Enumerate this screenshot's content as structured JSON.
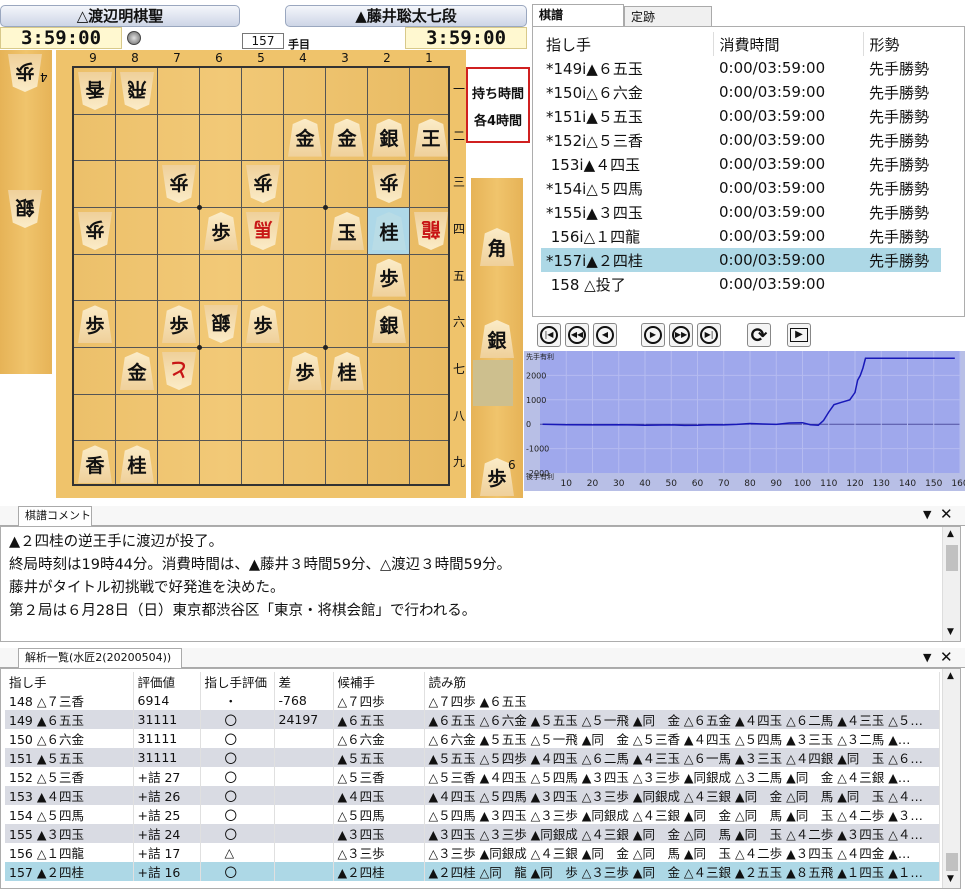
{
  "players": {
    "gote_name": "△渡辺明棋聖",
    "sente_name": "▲藤井聡太七段",
    "gote_clock": "3:59:00",
    "sente_clock": "3:59:00",
    "move_number": "157",
    "move_unit": "手目"
  },
  "time_limit": {
    "line1": "持ち時間",
    "line2": "各4時間"
  },
  "board": {
    "col_labels": [
      "9",
      "8",
      "7",
      "6",
      "5",
      "4",
      "3",
      "2",
      "1"
    ],
    "row_labels": [
      "一",
      "二",
      "三",
      "四",
      "五",
      "六",
      "七",
      "八",
      "九"
    ],
    "pieces": [
      {
        "c": 0,
        "r": 0,
        "t": "香",
        "s": "gote"
      },
      {
        "c": 1,
        "r": 0,
        "t": "飛",
        "s": "gote"
      },
      {
        "c": 5,
        "r": 1,
        "t": "金",
        "s": "sente"
      },
      {
        "c": 6,
        "r": 1,
        "t": "金",
        "s": "sente"
      },
      {
        "c": 7,
        "r": 1,
        "t": "銀",
        "s": "sente"
      },
      {
        "c": 8,
        "r": 1,
        "t": "王",
        "s": "sente"
      },
      {
        "c": 2,
        "r": 2,
        "t": "歩",
        "s": "gote"
      },
      {
        "c": 4,
        "r": 2,
        "t": "歩",
        "s": "gote"
      },
      {
        "c": 7,
        "r": 2,
        "t": "歩",
        "s": "gote"
      },
      {
        "c": 0,
        "r": 3,
        "t": "歩",
        "s": "gote"
      },
      {
        "c": 3,
        "r": 3,
        "t": "歩",
        "s": "sente"
      },
      {
        "c": 4,
        "r": 3,
        "t": "馬",
        "s": "gote",
        "red": true
      },
      {
        "c": 6,
        "r": 3,
        "t": "玉",
        "s": "sente"
      },
      {
        "c": 7,
        "r": 3,
        "t": "桂",
        "s": "sente",
        "hl": true
      },
      {
        "c": 8,
        "r": 3,
        "t": "龍",
        "s": "gote",
        "red": true
      },
      {
        "c": 7,
        "r": 4,
        "t": "歩",
        "s": "sente"
      },
      {
        "c": 0,
        "r": 5,
        "t": "歩",
        "s": "sente"
      },
      {
        "c": 2,
        "r": 5,
        "t": "歩",
        "s": "sente"
      },
      {
        "c": 3,
        "r": 5,
        "t": "銀",
        "s": "gote"
      },
      {
        "c": 4,
        "r": 5,
        "t": "歩",
        "s": "sente"
      },
      {
        "c": 7,
        "r": 5,
        "t": "銀",
        "s": "sente"
      },
      {
        "c": 1,
        "r": 6,
        "t": "金",
        "s": "sente"
      },
      {
        "c": 2,
        "r": 6,
        "t": "と",
        "s": "gote",
        "red": true
      },
      {
        "c": 5,
        "r": 6,
        "t": "歩",
        "s": "sente"
      },
      {
        "c": 6,
        "r": 6,
        "t": "桂",
        "s": "sente"
      },
      {
        "c": 0,
        "r": 8,
        "t": "香",
        "s": "sente"
      },
      {
        "c": 1,
        "r": 8,
        "t": "桂",
        "s": "sente"
      }
    ]
  },
  "hands": {
    "gote": [
      {
        "t": "歩",
        "count": "4"
      },
      {
        "t": "銀",
        "count": ""
      }
    ],
    "sente": [
      {
        "t": "角",
        "count": ""
      },
      {
        "t": "銀",
        "count": ""
      },
      {
        "t": "歩",
        "count": "6"
      }
    ]
  },
  "tabs": {
    "kifu": "棋譜",
    "track": "定跡"
  },
  "kifu": {
    "headers": [
      "指し手",
      "消費時間",
      "形勢"
    ],
    "rows": [
      {
        "move": "*149i▲６五玉",
        "time": "0:00/03:59:00",
        "eval": "先手勝勢"
      },
      {
        "move": "*150i△６六金",
        "time": "0:00/03:59:00",
        "eval": "先手勝勢"
      },
      {
        "move": "*151i▲５五玉",
        "time": "0:00/03:59:00",
        "eval": "先手勝勢"
      },
      {
        "move": "*152i△５三香",
        "time": "0:00/03:59:00",
        "eval": "先手勝勢"
      },
      {
        "move": " 153i▲４四玉",
        "time": "0:00/03:59:00",
        "eval": "先手勝勢"
      },
      {
        "move": "*154i△５四馬",
        "time": "0:00/03:59:00",
        "eval": "先手勝勢"
      },
      {
        "move": "*155i▲３四玉",
        "time": "0:00/03:59:00",
        "eval": "先手勝勢"
      },
      {
        "move": " 156i△１四龍",
        "time": "0:00/03:59:00",
        "eval": "先手勝勢"
      },
      {
        "move": "*157i▲２四桂",
        "time": "0:00/03:59:00",
        "eval": "先手勝勢"
      },
      {
        "move": " 158 △投了",
        "time": "0:00/03:59:00",
        "eval": ""
      }
    ],
    "selected": 8
  },
  "graph": {
    "top_label": "先手有利",
    "bottom_label": "後手有利",
    "y_ticks": [
      "2000",
      "1000",
      "0",
      "-1000",
      "-2000"
    ],
    "x_ticks": [
      "10",
      "20",
      "30",
      "40",
      "50",
      "60",
      "70",
      "80",
      "90",
      "100",
      "110",
      "120",
      "130",
      "140",
      "150",
      "160"
    ]
  },
  "chart_data": {
    "type": "line",
    "title": "",
    "xlabel": "",
    "ylabel": "",
    "xlim": [
      0,
      160
    ],
    "ylim": [
      -2000,
      3000
    ],
    "series": [
      {
        "name": "",
        "x": [
          1,
          10,
          20,
          30,
          40,
          50,
          55,
          60,
          65,
          70,
          75,
          80,
          85,
          90,
          95,
          100,
          103,
          106,
          108,
          110,
          112,
          115,
          118,
          120,
          121,
          122,
          123,
          124,
          130,
          140,
          150,
          158
        ],
        "values": [
          0,
          -20,
          -30,
          -20,
          -40,
          -30,
          -50,
          -40,
          -20,
          -30,
          -10,
          30,
          10,
          -10,
          50,
          60,
          -20,
          -40,
          150,
          500,
          800,
          900,
          1000,
          1300,
          1800,
          2000,
          2300,
          2700,
          2700,
          2700,
          2700,
          2700
        ]
      }
    ]
  },
  "comment": {
    "tab": "棋譜コメント",
    "lines": [
      "▲２四桂の逆王手に渡辺が投了。",
      "終局時刻は19時44分。消費時間は、▲藤井３時間59分、△渡辺３時間59分。",
      "藤井がタイトル初挑戦で好発進を決めた。",
      "第２局は６月28日（日）東京都渋谷区「東京・将棋会館」で行われる。"
    ]
  },
  "analysis": {
    "tab": "解析一覧(水匠2(20200504))",
    "headers": [
      "指し手",
      "評価値",
      "指し手評価",
      "差",
      "候補手",
      "読み筋"
    ],
    "rows": [
      {
        "move": "148 △７三香",
        "score": "6914",
        "mark": "・",
        "diff": "-768",
        "cand": "△７四歩",
        "pv": "△７四歩 ▲６五玉"
      },
      {
        "move": "149 ▲６五玉",
        "score": "31111",
        "mark": "〇",
        "diff": "24197",
        "cand": "▲６五玉",
        "pv": "▲６五玉 △６六金 ▲５五玉 △５一飛 ▲同　金 △６五金 ▲４四玉 △６二馬 ▲４三玉 △５…"
      },
      {
        "move": "150 △６六金",
        "score": "31111",
        "mark": "〇",
        "diff": "",
        "cand": "△６六金",
        "pv": "△６六金 ▲５五玉 △５一飛 ▲同　金 △５三香 ▲４四玉 △５四馬 ▲３三玉 △３二馬 ▲…"
      },
      {
        "move": "151 ▲５五玉",
        "score": "31111",
        "mark": "〇",
        "diff": "",
        "cand": "▲５五玉",
        "pv": "▲５五玉 △５四歩 ▲４四玉 △６二馬 ▲４三玉 △６一馬 ▲３三玉 △４四銀 ▲同　玉 △６…"
      },
      {
        "move": "152 △５三香",
        "score": "+詰 27",
        "mark": "〇",
        "diff": "",
        "cand": "△５三香",
        "pv": "△５三香 ▲４四玉 △５四馬 ▲３四玉 △３三歩 ▲同銀成 △３二馬 ▲同　金 △４三銀 ▲…"
      },
      {
        "move": "153 ▲４四玉",
        "score": "+詰 26",
        "mark": "〇",
        "diff": "",
        "cand": "▲４四玉",
        "pv": "▲４四玉 △５四馬 ▲３四玉 △３三歩 ▲同銀成 △４三銀 ▲同　金 △同　馬 ▲同　玉 △４…"
      },
      {
        "move": "154 △５四馬",
        "score": "+詰 25",
        "mark": "〇",
        "diff": "",
        "cand": "△５四馬",
        "pv": "△５四馬 ▲３四玉 △３三歩 ▲同銀成 △４三銀 ▲同　金 △同　馬 ▲同　玉 △４二歩 ▲３…"
      },
      {
        "move": "155 ▲３四玉",
        "score": "+詰 24",
        "mark": "〇",
        "diff": "",
        "cand": "▲３四玉",
        "pv": "▲３四玉 △３三歩 ▲同銀成 △４三銀 ▲同　金 △同　馬 ▲同　玉 △４二歩 ▲３四玉 △４…"
      },
      {
        "move": "156 △１四龍",
        "score": "+詰 17",
        "mark": "△",
        "diff": "",
        "cand": "△３三歩",
        "pv": "△３三歩 ▲同銀成 △４三銀 ▲同　金 △同　馬 ▲同　玉 △４二歩 ▲３四玉 △４四金 ▲…"
      },
      {
        "move": "157 ▲２四桂",
        "score": "+詰 16",
        "mark": "〇",
        "diff": "",
        "cand": "▲２四桂",
        "pv": "▲２四桂 △同　龍 ▲同　歩 △３三歩 ▲同　金 △４三銀 ▲２五玉 ▲８五飛 ▲１四玉 ▲１…"
      }
    ],
    "selected": 9
  },
  "colors": {
    "selection": "#add8e6",
    "graph_bg": "#9fa8ec",
    "graph_line": "#1818b8",
    "board": "#efc36b"
  }
}
